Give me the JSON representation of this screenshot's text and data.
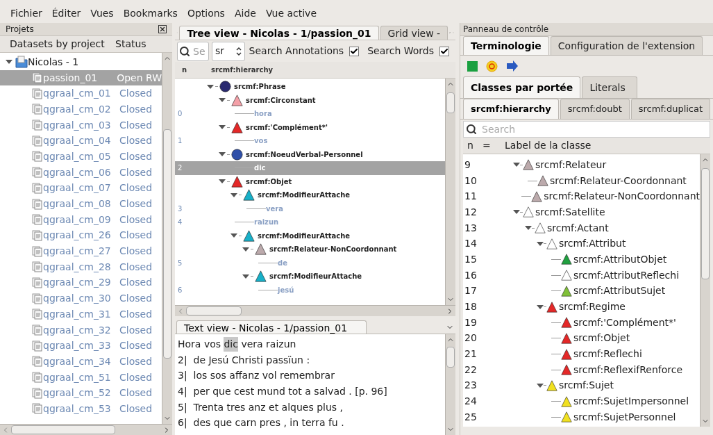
{
  "menu": [
    "Fichier",
    "Éditer",
    "Vues",
    "Bookmarks",
    "Options",
    "Aide",
    "Vue active"
  ],
  "projects": {
    "title": "Projets",
    "columns": [
      "Datasets by project",
      "Status"
    ],
    "project": {
      "label": "Nicolas - 1",
      "expanded": true
    },
    "datasets": [
      {
        "name": "passion_01",
        "status": "Open RW",
        "selected": true
      },
      {
        "name": "qgraal_cm_01",
        "status": "Closed",
        "selected": false
      },
      {
        "name": "qgraal_cm_02",
        "status": "Closed",
        "selected": false
      },
      {
        "name": "qgraal_cm_03",
        "status": "Closed",
        "selected": false
      },
      {
        "name": "qgraal_cm_04",
        "status": "Closed",
        "selected": false
      },
      {
        "name": "qgraal_cm_05",
        "status": "Closed",
        "selected": false
      },
      {
        "name": "qgraal_cm_06",
        "status": "Closed",
        "selected": false
      },
      {
        "name": "qgraal_cm_07",
        "status": "Closed",
        "selected": false
      },
      {
        "name": "qgraal_cm_08",
        "status": "Closed",
        "selected": false
      },
      {
        "name": "qgraal_cm_09",
        "status": "Closed",
        "selected": false
      },
      {
        "name": "qgraal_cm_26",
        "status": "Closed",
        "selected": false
      },
      {
        "name": "qgraal_cm_27",
        "status": "Closed",
        "selected": false
      },
      {
        "name": "qgraal_cm_28",
        "status": "Closed",
        "selected": false
      },
      {
        "name": "qgraal_cm_29",
        "status": "Closed",
        "selected": false
      },
      {
        "name": "qgraal_cm_30",
        "status": "Closed",
        "selected": false
      },
      {
        "name": "qgraal_cm_31",
        "status": "Closed",
        "selected": false
      },
      {
        "name": "qgraal_cm_32",
        "status": "Closed",
        "selected": false
      },
      {
        "name": "qgraal_cm_33",
        "status": "Closed",
        "selected": false
      },
      {
        "name": "qgraal_cm_34",
        "status": "Closed",
        "selected": false
      },
      {
        "name": "qgraal_cm_51",
        "status": "Closed",
        "selected": false
      },
      {
        "name": "qgraal_cm_52",
        "status": "Closed",
        "selected": false
      },
      {
        "name": "qgraal_cm_53",
        "status": "Closed",
        "selected": false
      }
    ]
  },
  "tree_view": {
    "tabs": [
      {
        "label": "Tree view - Nicolas - 1/passion_01",
        "selected": true
      },
      {
        "label": "Grid view -",
        "selected": false
      }
    ],
    "search": {
      "placeholder": "Se"
    },
    "combo": {
      "value": "sr"
    },
    "checkboxes": [
      {
        "label": "Search Annotations",
        "checked": true
      },
      {
        "label": "Search Words",
        "checked": true
      }
    ],
    "columns": [
      "n",
      "srcmf:hierarchy"
    ],
    "nodes": [
      {
        "label": "srcmf:Phrase",
        "kind": "circle",
        "color": "#2a2a70",
        "expanded": true,
        "selected": false,
        "children": [
          {
            "label": "srcmf:Circonstant",
            "kind": "triangle",
            "color": "#f4a0a8",
            "expanded": true,
            "selected": false,
            "children": [
              {
                "label": "hora",
                "kind": "word",
                "n": "0",
                "selected": false
              }
            ]
          },
          {
            "label": "srcmf:'Complément*'",
            "kind": "triangle",
            "color": "#e42828",
            "expanded": true,
            "selected": false,
            "children": [
              {
                "label": "vos",
                "kind": "word",
                "n": "1",
                "selected": false
              }
            ]
          },
          {
            "label": "srcmf:NoeudVerbal-Personnel",
            "kind": "circle",
            "color": "#3050a8",
            "expanded": true,
            "selected": false,
            "children": [
              {
                "label": "dic",
                "kind": "word",
                "n": "2",
                "selected": true
              }
            ]
          },
          {
            "label": "srcmf:Objet",
            "kind": "triangle",
            "color": "#e42828",
            "expanded": true,
            "selected": false,
            "children": [
              {
                "label": "srcmf:ModifieurAttache",
                "kind": "triangle",
                "color": "#18b0c8",
                "expanded": true,
                "selected": false,
                "children": [
                  {
                    "label": "vera",
                    "kind": "word",
                    "n": "3",
                    "selected": false
                  }
                ]
              },
              {
                "label": "raizun",
                "kind": "word",
                "n": "4",
                "selected": false
              },
              {
                "label": "srcmf:ModifieurAttache",
                "kind": "triangle",
                "color": "#18b0c8",
                "expanded": true,
                "selected": false,
                "children": [
                  {
                    "label": "srcmf:Relateur-NonCoordonnant",
                    "kind": "triangle",
                    "color": "#bcaaac",
                    "expanded": true,
                    "selected": false,
                    "children": [
                      {
                        "label": "de",
                        "kind": "word",
                        "n": "5",
                        "selected": false
                      }
                    ]
                  },
                  {
                    "label": "srcmf:ModifieurAttache",
                    "kind": "triangle",
                    "color": "#18b0c8",
                    "expanded": true,
                    "selected": false,
                    "children": [
                      {
                        "label": "jesú",
                        "kind": "word",
                        "n": "6",
                        "selected": false
                      }
                    ]
                  }
                ]
              }
            ]
          }
        ]
      }
    ]
  },
  "text_view": {
    "tab": {
      "label": "Text view - Nicolas - 1/passion_01",
      "selected": true
    },
    "lines": [
      [
        {
          "text": "Hora vos ",
          "highlighted": false
        },
        {
          "text": "dic",
          "highlighted": true
        },
        {
          "text": " vera raizun",
          "highlighted": false
        }
      ],
      [
        {
          "text": "2|  de Jesú Christi passïun :",
          "highlighted": false
        }
      ],
      [
        {
          "text": "3|  los sos affanz vol remembrar",
          "highlighted": false
        }
      ],
      [
        {
          "text": "4|  per que cest mund tot a salvad . [p. 96]",
          "highlighted": false
        }
      ],
      [
        {
          "text": "5|  Trenta tres anz et alques plus ,",
          "highlighted": false
        }
      ],
      [
        {
          "text": "6|  des que carn pres , in terra fu .",
          "highlighted": false
        }
      ]
    ]
  },
  "control_panel": {
    "title": "Panneau de contrôle",
    "tabs": [
      {
        "label": "Terminologie",
        "selected": true
      },
      {
        "label": "Configuration de l'extension",
        "selected": false
      }
    ],
    "tabs2": [
      {
        "label": "Classes par portée",
        "selected": true
      },
      {
        "label": "Literals",
        "selected": false
      }
    ],
    "tabs3": [
      {
        "label": "srcmf:hierarchy",
        "selected": true
      },
      {
        "label": "srcmf:doubt",
        "selected": false
      },
      {
        "label": "srcmf:duplicat",
        "selected": false
      }
    ],
    "search": {
      "placeholder": "Search"
    },
    "columns": [
      "n",
      "=",
      "Label de la classe"
    ],
    "classes": [
      {
        "n": "9",
        "label": "srcmf:Relateur",
        "color": "#bcaaac",
        "expanded": true,
        "children": [
          {
            "n": "10",
            "label": "srcmf:Relateur-Coordonnant",
            "color": "#bcaaac"
          },
          {
            "n": "11",
            "label": "srcmf:Relateur-NonCoordonnant",
            "color": "#bcaaac"
          }
        ]
      },
      {
        "n": "12",
        "label": "srcmf:Satellite",
        "color": "#ffffff",
        "expanded": true,
        "children": [
          {
            "n": "13",
            "label": "srcmf:Actant",
            "color": "#ffffff",
            "expanded": true,
            "children": [
              {
                "n": "14",
                "label": "srcmf:Attribut",
                "color": "#ffffff",
                "expanded": true,
                "children": [
                  {
                    "n": "15",
                    "label": "srcmf:AttributObjet",
                    "color": "#20a040"
                  },
                  {
                    "n": "16",
                    "label": "srcmf:AttributReflechi",
                    "color": "#ffffff"
                  },
                  {
                    "n": "17",
                    "label": "srcmf:AttributSujet",
                    "color": "#80c038"
                  }
                ]
              },
              {
                "n": "18",
                "label": "srcmf:Regime",
                "color": "#e42828",
                "expanded": true,
                "children": [
                  {
                    "n": "19",
                    "label": "srcmf:'Complément*'",
                    "color": "#e42828"
                  },
                  {
                    "n": "20",
                    "label": "srcmf:Objet",
                    "color": "#e42828"
                  },
                  {
                    "n": "21",
                    "label": "srcmf:Reflechi",
                    "color": "#e42828"
                  },
                  {
                    "n": "22",
                    "label": "srcmf:ReflexifRenforce",
                    "color": "#e42828"
                  }
                ]
              },
              {
                "n": "23",
                "label": "srcmf:Sujet",
                "color": "#f0e020",
                "expanded": true,
                "children": [
                  {
                    "n": "24",
                    "label": "srcmf:SujetImpersonnel",
                    "color": "#f0e020"
                  },
                  {
                    "n": "25",
                    "label": "srcmf:SujetPersonnel",
                    "color": "#f0e020"
                  }
                ]
              }
            ]
          }
        ]
      }
    ]
  }
}
